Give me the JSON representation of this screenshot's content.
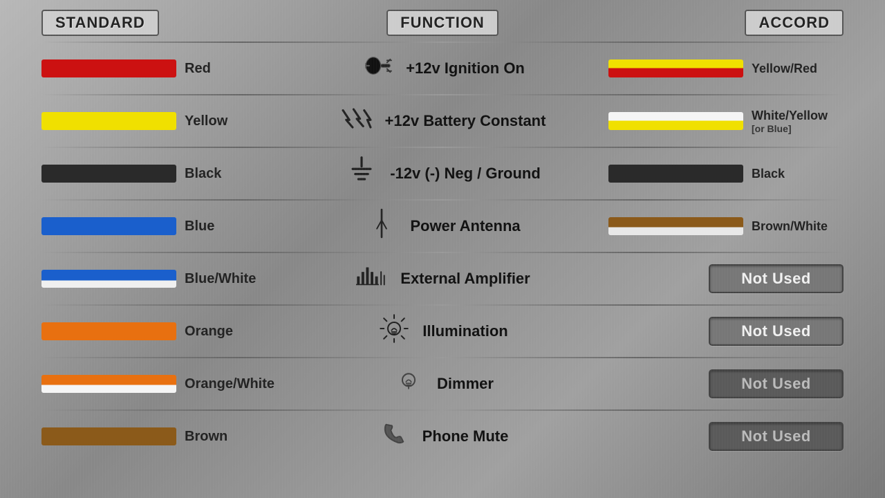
{
  "headers": {
    "standard": "STANDARD",
    "function": "FUNCTION",
    "accord": "ACCORD"
  },
  "rows": [
    {
      "id": "red",
      "standard_label": "Red",
      "standard_swatch": "swatch-red",
      "function_text": "+12v  Ignition On",
      "function_icon": "ignition",
      "accord_label": "Yellow/Red",
      "accord_label2": "",
      "accord_swatch": "swatch-yellow-red",
      "not_used": false
    },
    {
      "id": "yellow",
      "standard_label": "Yellow",
      "standard_swatch": "swatch-yellow",
      "function_text": "+12v  Battery Constant",
      "function_icon": "lightning",
      "accord_label": "White/Yellow",
      "accord_label2": "[or Blue]",
      "accord_swatch": "swatch-white-yellow",
      "not_used": false
    },
    {
      "id": "black",
      "standard_label": "Black",
      "standard_swatch": "swatch-black",
      "function_text": "-12v (-) Neg / Ground",
      "function_icon": "ground",
      "accord_label": "Black",
      "accord_label2": "",
      "accord_swatch": "swatch-black-accord",
      "not_used": false
    },
    {
      "id": "blue",
      "standard_label": "Blue",
      "standard_swatch": "swatch-blue",
      "function_text": "Power  Antenna",
      "function_icon": "antenna",
      "accord_label": "Brown/White",
      "accord_label2": "",
      "accord_swatch": "swatch-brown-white",
      "not_used": false
    },
    {
      "id": "blue-white",
      "standard_label": "Blue/White",
      "standard_swatch": "swatch-blue-white",
      "function_text": "External Amplifier",
      "function_icon": "amplifier",
      "accord_label": "",
      "accord_label2": "",
      "accord_swatch": "",
      "not_used": true,
      "not_used_label": "Not Used",
      "not_used_style": "bright"
    },
    {
      "id": "orange",
      "standard_label": "Orange",
      "standard_swatch": "swatch-orange",
      "function_text": "Illumination",
      "function_icon": "bulb-bright",
      "accord_label": "",
      "accord_label2": "",
      "accord_swatch": "",
      "not_used": true,
      "not_used_label": "Not Used",
      "not_used_style": "bright"
    },
    {
      "id": "orange-white",
      "standard_label": "Orange/White",
      "standard_swatch": "swatch-orange-white",
      "function_text": "Dimmer",
      "function_icon": "bulb-dim",
      "accord_label": "",
      "accord_label2": "",
      "accord_swatch": "",
      "not_used": true,
      "not_used_label": "Not Used",
      "not_used_style": "dim"
    },
    {
      "id": "brown",
      "standard_label": "Brown",
      "standard_swatch": "swatch-brown",
      "function_text": "Phone Mute",
      "function_icon": "phone",
      "accord_label": "",
      "accord_label2": "",
      "accord_swatch": "",
      "not_used": true,
      "not_used_label": "Not Used",
      "not_used_style": "dim"
    }
  ]
}
